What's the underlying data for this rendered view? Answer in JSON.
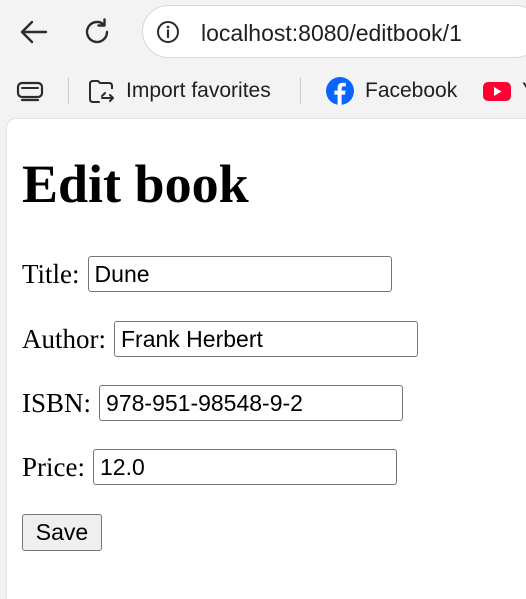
{
  "browser": {
    "url": "localhost:8080/editbook/1",
    "back_icon": "back-arrow-icon",
    "reload_icon": "reload-icon",
    "site_info_icon": "info-icon"
  },
  "favorites_bar": {
    "collections_icon": "collections-icon",
    "items": [
      {
        "label": "Import favorites",
        "icon": "import-favorites-icon"
      },
      {
        "label": "Facebook",
        "icon": "facebook-icon",
        "color": "#0866ff"
      },
      {
        "label": "Y",
        "icon": "youtube-icon",
        "color": "#ff0033"
      }
    ]
  },
  "page": {
    "heading": "Edit book",
    "fields": {
      "title": {
        "label": "Title:",
        "value": "Dune"
      },
      "author": {
        "label": "Author:",
        "value": "Frank Herbert"
      },
      "isbn": {
        "label": "ISBN:",
        "value": "978-951-98548-9-2"
      },
      "price": {
        "label": "Price:",
        "value": "12.0"
      }
    },
    "save_label": "Save"
  }
}
